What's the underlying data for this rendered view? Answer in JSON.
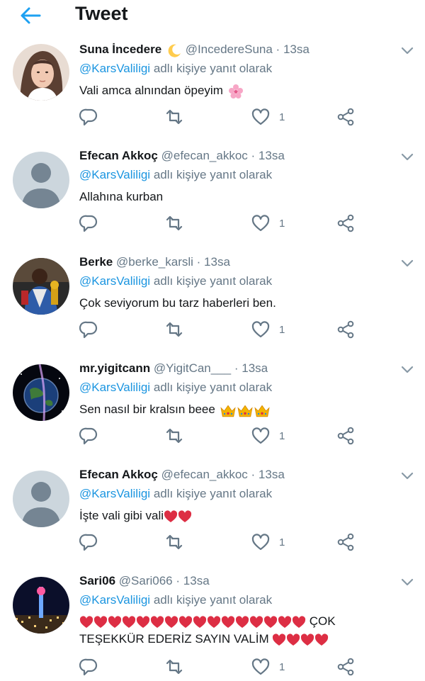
{
  "header": {
    "title": "Tweet",
    "back_icon": "arrow-left-icon"
  },
  "colors": {
    "accent": "#1da1f2",
    "link": "#1b95e0",
    "muted": "#657786",
    "divider": "#e1e8ed",
    "heart_red": "#e0245e"
  },
  "tweets": [
    {
      "name": "Suna İncedere",
      "name_emoji": "crescent-moon-emoji",
      "handle": "@IncedereSuna",
      "dot": "·",
      "time": "13sa",
      "reply_prefix": "@KarsValiligi",
      "reply_suffix": "adlı kişiye yanıt olarak",
      "text": "Vali amca alnından öpeyim",
      "text_emoji": "cherry-blossom-emoji",
      "likes": "1"
    },
    {
      "name": "Efecan Akkoç",
      "handle": "@efecan_akkoc",
      "dot": "·",
      "time": "13sa",
      "reply_prefix": "@KarsValiligi",
      "reply_suffix": "adlı kişiye yanıt olarak",
      "text": "Allahına kurban",
      "likes": "1"
    },
    {
      "name": "Berke",
      "handle": "@berke_karsli",
      "dot": "·",
      "time": "13sa",
      "reply_prefix": "@KarsValiligi",
      "reply_suffix": "adlı kişiye yanıt olarak",
      "text": "Çok seviyorum bu tarz haberleri ben.",
      "likes": "1"
    },
    {
      "name": "mr.yigitcann",
      "handle": "@YigitCan___",
      "dot": "·",
      "time": "13sa",
      "reply_prefix": "@KarsValiligi",
      "reply_suffix": "adlı kişiye yanıt olarak",
      "text": "Sen nasıl bir kralsın beee",
      "text_emoji": "crown-emoji",
      "likes": "1"
    },
    {
      "name": "Efecan Akkoç",
      "handle": "@efecan_akkoc",
      "dot": "·",
      "time": "13sa",
      "reply_prefix": "@KarsValiligi",
      "reply_suffix": "adlı kişiye yanıt olarak",
      "text": "İşte vali gibi vali",
      "text_emoji": "red-heart-emoji",
      "likes": "1"
    },
    {
      "name": "Sari06",
      "handle": "@Sari066",
      "dot": "·",
      "time": "13sa",
      "reply_prefix": "@KarsValiligi",
      "reply_suffix": "adlı kişiye yanıt olarak",
      "text_line1": "ÇOK",
      "text_line2": "TEŞEKKÜR EDERİZ SAYIN VALİM",
      "text_emoji": "red-heart-emoji",
      "likes": "1"
    }
  ]
}
